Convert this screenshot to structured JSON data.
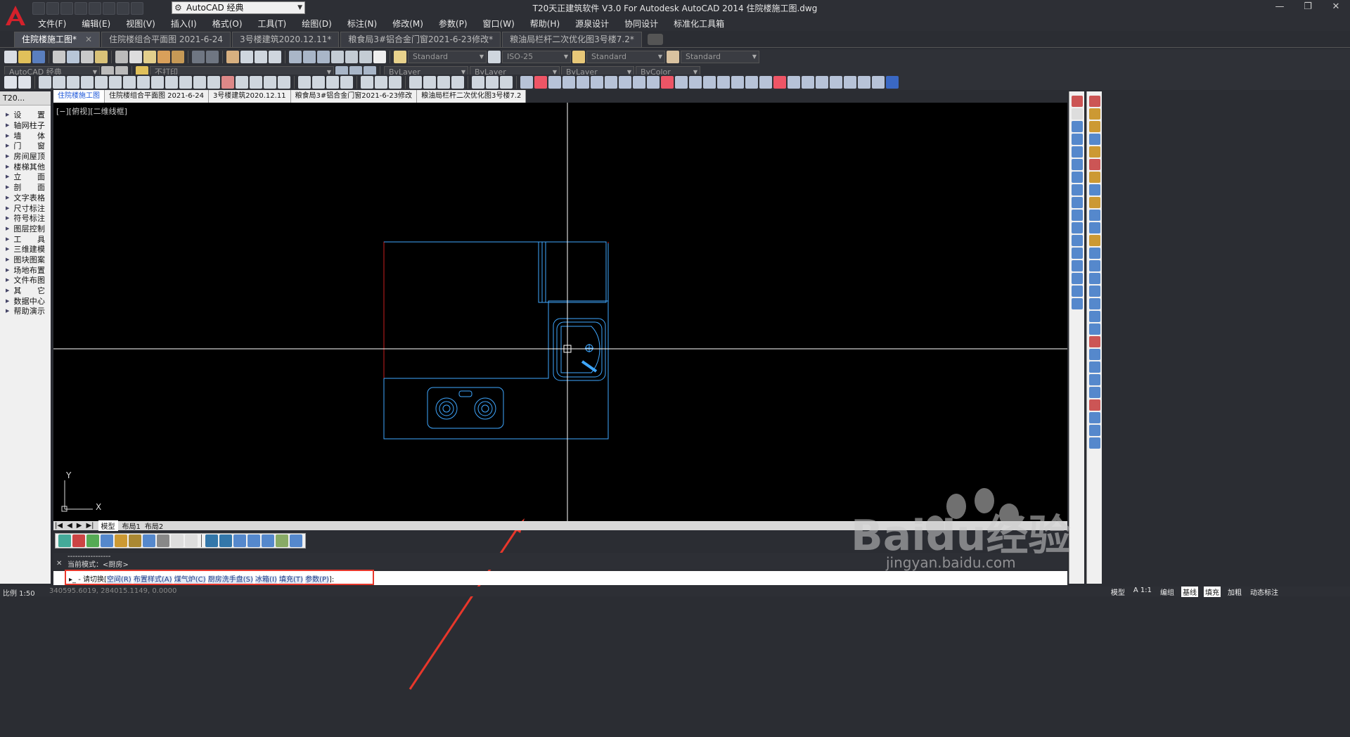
{
  "app": {
    "title": "T20天正建筑软件 V3.0 For Autodesk AutoCAD 2014    住院楼施工图.dwg",
    "workspace": "AutoCAD 经典",
    "window_controls": [
      "—",
      "❐",
      "✕"
    ]
  },
  "menu": [
    "文件(F)",
    "编辑(E)",
    "视图(V)",
    "插入(I)",
    "格式(O)",
    "工具(T)",
    "绘图(D)",
    "标注(N)",
    "修改(M)",
    "参数(P)",
    "窗口(W)",
    "帮助(H)",
    "源泉设计",
    "协同设计",
    "标准化工具箱"
  ],
  "doc_tabs": [
    {
      "label": "住院楼施工图*",
      "active": true
    },
    {
      "label": "住院楼组合平面图 2021-6-24"
    },
    {
      "label": "3号楼建筑2020.12.11*"
    },
    {
      "label": "粮食局3#铝合金门窗2021-6-23修改*"
    },
    {
      "label": "粮油局栏杆二次优化图3号楼7.2*"
    }
  ],
  "styles_toolbar": {
    "text_style": "Standard",
    "dim_style": "ISO-25",
    "table_style": "Standard",
    "mleader_style": "Standard"
  },
  "layers_toolbar": {
    "workspace": "AutoCAD 经典",
    "layer": "不打印",
    "color": "ByLayer",
    "linetype": "ByLayer",
    "lineweight": "ByLayer",
    "plotstyle": "ByColor"
  },
  "left_panel": {
    "header": "T20...",
    "items": [
      "设　置",
      "轴网柱子",
      "墙　体",
      "门　窗",
      "房间屋顶",
      "楼梯其他",
      "立　面",
      "剖　面",
      "文字表格",
      "尺寸标注",
      "符号标注",
      "图层控制",
      "工　具",
      "三维建模",
      "图块图案",
      "场地布置",
      "文件布图",
      "其　它",
      "数据中心",
      "帮助演示"
    ]
  },
  "drawing_tabs": [
    "住院楼施工图",
    "住院楼组合平面图 2021-6-24",
    "3号楼建筑2020.12.11",
    "粮食局3#铝合金门窗2021-6-23修改",
    "粮油局栏杆二次优化图3号楼7.2"
  ],
  "viewport_label": "[−][俯视][二维线框]",
  "layout_tabs": [
    "模型",
    "布局1",
    "布局2"
  ],
  "ucs": {
    "x": "X",
    "y": "Y"
  },
  "command": {
    "history_line1": "-----------------",
    "history_line2": "当前模式：<厨房>",
    "prompt_prefix": "- 请切换[",
    "options": [
      "空间(R)",
      "布置样式(A)",
      "煤气炉(C)",
      "厨房洗手盘(S)",
      "冰箱(I)",
      "填充(T)",
      "参数(P)"
    ],
    "prompt_suffix": "]:"
  },
  "status": {
    "scale": "比例 1:50",
    "coords": "340595.6019, 284015.1149, 0.0000",
    "right_items": [
      "模型",
      "A 1:1",
      "编组",
      "基线",
      "填充",
      "加粗",
      "动态标注"
    ]
  },
  "watermark": {
    "brand": "Baidu经验",
    "url": "jingyan.baidu.com"
  },
  "colors": {
    "canvas": "#000000",
    "fixture": "#3fa7ff",
    "room_boundary": "#c81e1e",
    "crosshair": "#ffffff",
    "highlight": "#e8372b"
  }
}
